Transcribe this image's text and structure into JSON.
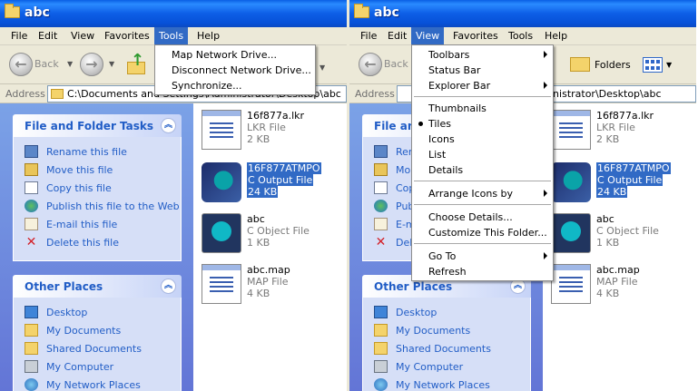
{
  "left": {
    "title": "abc",
    "menus": [
      "File",
      "Edit",
      "View",
      "Favorites",
      "Tools",
      "Help"
    ],
    "active_menu": "Tools",
    "tools_menu": [
      "Map Network Drive...",
      "Disconnect Network Drive...",
      "Synchronize..."
    ],
    "toolbar": {
      "back": "Back"
    },
    "address": {
      "label": "Address",
      "value": "C:\\Documents and Settings\\Administrator\\Desktop\\abc"
    },
    "file_tasks": {
      "header": "File and Folder Tasks",
      "items": [
        "Rename this file",
        "Move this file",
        "Copy this file",
        "Publish this file to the Web",
        "E-mail this file",
        "Delete this file"
      ]
    },
    "other_places": {
      "header": "Other Places",
      "items": [
        "Desktop",
        "My Documents",
        "Shared Documents",
        "My Computer",
        "My Network Places"
      ]
    }
  },
  "right": {
    "title": "abc",
    "menus": [
      "File",
      "Edit",
      "View",
      "Favorites",
      "Tools",
      "Help"
    ],
    "active_menu": "View",
    "toolbar": {
      "back": "Back",
      "folders": "Folders"
    },
    "address": {
      "label": "Address",
      "value": "inistrator\\Desktop\\abc"
    },
    "view_menu": {
      "group1": [
        "Toolbars",
        "Status Bar",
        "Explorer Bar"
      ],
      "group2": [
        "Thumbnails",
        "Tiles",
        "Icons",
        "List",
        "Details"
      ],
      "checked": "Tiles",
      "group3": [
        "Arrange Icons by"
      ],
      "group4": [
        "Choose Details...",
        "Customize This Folder..."
      ],
      "group5": [
        "Go To",
        "Refresh"
      ]
    },
    "file_tasks": {
      "header": "File and Folder Tasks",
      "items": [
        "Ren",
        "Mo",
        "Cop",
        "Publ",
        "E-m",
        "Dele"
      ]
    },
    "other_places": {
      "header": "Other Places",
      "items": [
        "Desktop",
        "My Documents",
        "Shared Documents",
        "My Computer",
        "My Network Places"
      ]
    }
  },
  "files": [
    {
      "name": "16f877a.lkr",
      "type": "LKR File",
      "size": "2 KB",
      "icon": "lkr-document-icon"
    },
    {
      "name": "16F877ATMPO",
      "type": "C Output File",
      "size": "24 KB",
      "icon": "c-output-icon",
      "selected": true
    },
    {
      "name": "abc",
      "type": "C Object File",
      "size": "1 KB",
      "icon": "c-object-icon"
    },
    {
      "name": "abc.map",
      "type": "MAP File",
      "size": "4 KB",
      "icon": "map-document-icon"
    }
  ],
  "colors": {
    "title_blue": "#0a5fe4",
    "selection": "#316ac5",
    "task_pane": "#7ba2e7",
    "link": "#215dc6"
  }
}
